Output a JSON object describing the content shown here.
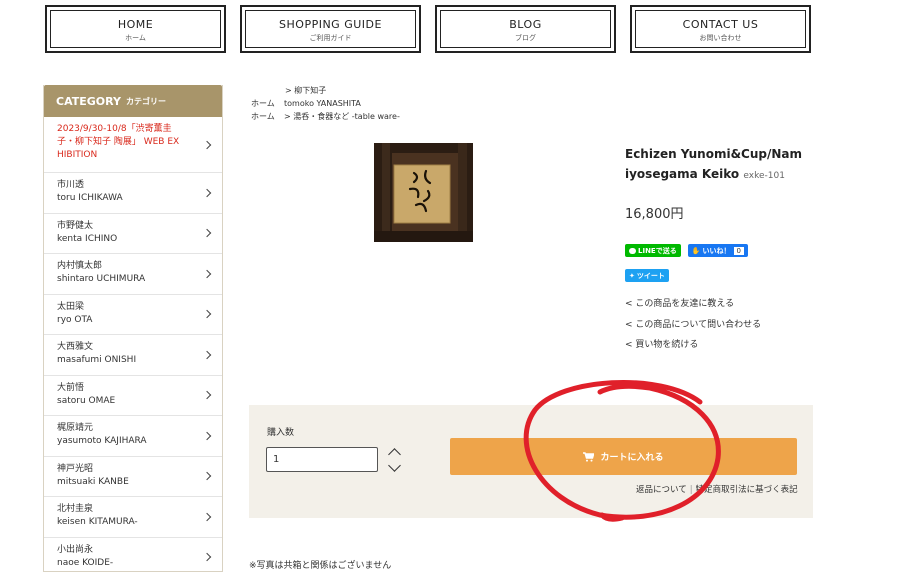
{
  "nav": [
    {
      "en": "HOME",
      "ja": "ホーム"
    },
    {
      "en": "SHOPPING GUIDE",
      "ja": "ご利用ガイド"
    },
    {
      "en": "BLOG",
      "ja": "ブログ"
    },
    {
      "en": "CONTACT US",
      "ja": "お問い合わせ"
    }
  ],
  "sidebar": {
    "title": "CATEGORY",
    "title_ja": "カテゴリー",
    "items": [
      {
        "line1": "2023/9/30-10/8「渋寄薫圭",
        "line2": "子・柳下知子 陶展」 WEB EX",
        "line3": "HIBITION"
      },
      {
        "line1": "市川透",
        "line2": "toru ICHIKAWA"
      },
      {
        "line1": "市野健太",
        "line2": "kenta ICHINO"
      },
      {
        "line1": "内村慎太郎",
        "line2": "shintaro UCHIMURA"
      },
      {
        "line1": "太田梁",
        "line2": "ryo OTA"
      },
      {
        "line1": "大西雅文",
        "line2": "masafumi ONISHI"
      },
      {
        "line1": "大前悟",
        "line2": "satoru OMAE"
      },
      {
        "line1": "梶原靖元",
        "line2": "yasumoto KAJIHARA"
      },
      {
        "line1": "神戸光昭",
        "line2": "mitsuaki KANBE"
      },
      {
        "line1": "北村圭泉",
        "line2": "keisen KITAMURA-"
      },
      {
        "line1": "小出尚永",
        "line2": "naoe KOIDE-"
      }
    ]
  },
  "breadcrumbs": {
    "row1": "> 柳下知子",
    "row2_home": "ホーム",
    "row2": "tomoko YANASHITA",
    "row3_home": "ホーム",
    "row3": "> 湯呑・食器など -table ware-"
  },
  "product": {
    "title_line1": "Echizen Yunomi&Cup/Nam",
    "title_line2": "iyosegama Keiko",
    "code": "exke-101",
    "price": "16,800円"
  },
  "social": {
    "line": "LINEで送る",
    "fb": "いいね！",
    "fb_count": "0",
    "tweet": "ツイート"
  },
  "links": [
    "< この商品を友達に教える",
    "< この商品について問い合わせる",
    "< 買い物を続ける"
  ],
  "cart": {
    "qty_label": "購入数",
    "qty_value": "1",
    "button": "カートに入れる",
    "returns": "返品について",
    "tokusho": "特定商取引法に基づく表記"
  },
  "note": "※写真は共箱と関係はございません",
  "colors": {
    "sidebar_header": "#a8956a",
    "cart_button": "#eea44a",
    "annotation": "#e0202a"
  }
}
